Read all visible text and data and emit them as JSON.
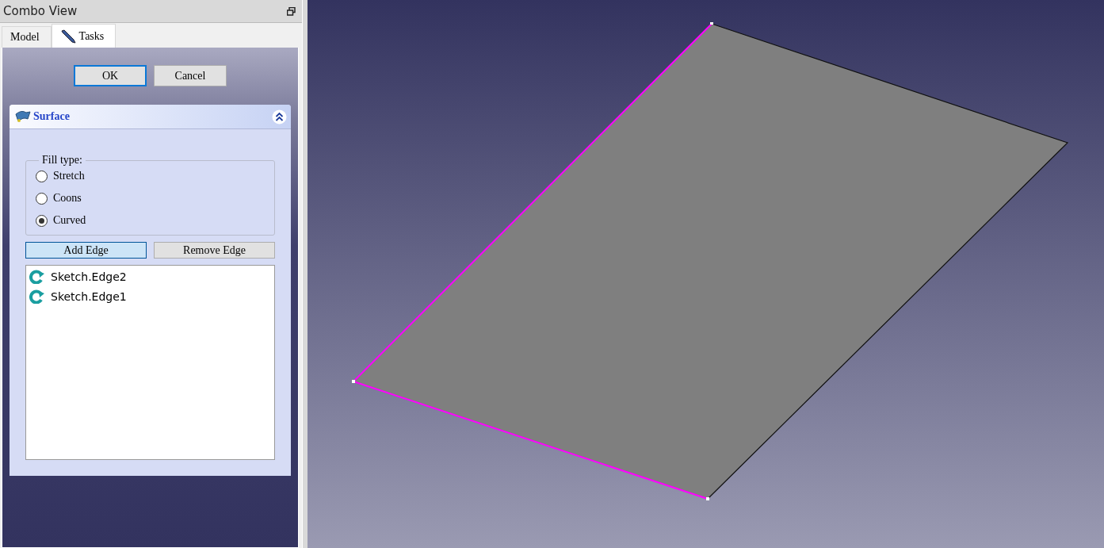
{
  "panel": {
    "title": "Combo View"
  },
  "tabs": [
    {
      "label": "Model",
      "selected": false,
      "kind": "plain"
    },
    {
      "label": "Tasks",
      "selected": true,
      "kind": "pencil"
    }
  ],
  "dialog_buttons": [
    {
      "label": "OK",
      "focused": true
    },
    {
      "label": "Cancel",
      "focused": false
    }
  ],
  "surface": {
    "title": "Surface",
    "fill_type": {
      "legend": "Fill type:",
      "options": [
        {
          "label": "Stretch",
          "selected": false
        },
        {
          "label": "Coons",
          "selected": false
        },
        {
          "label": "Curved",
          "selected": true
        }
      ]
    },
    "edge_buttons": [
      {
        "label": "Add Edge",
        "checked": true
      },
      {
        "label": "Remove Edge",
        "checked": false
      }
    ],
    "edges": [
      "Sketch.Edge2",
      "Sketch.Edge1"
    ]
  }
}
